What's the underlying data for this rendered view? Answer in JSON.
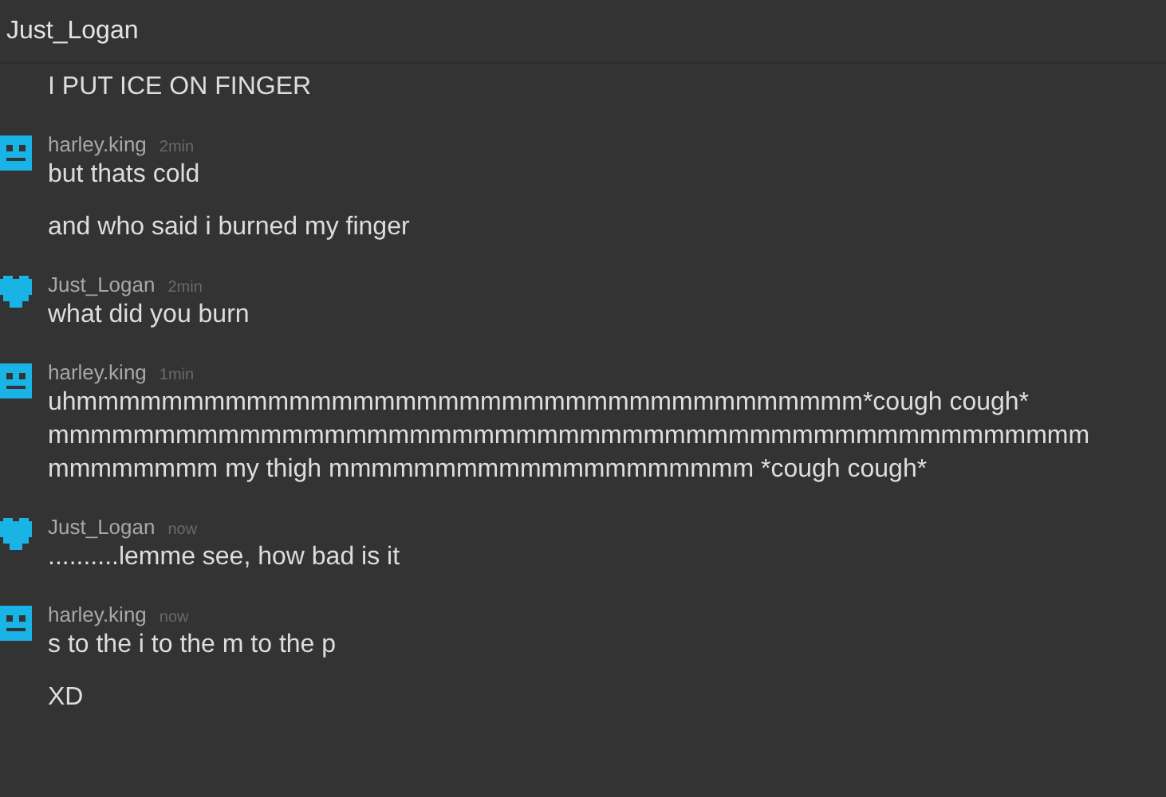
{
  "header": {
    "title": "Just_Logan"
  },
  "messages": [
    {
      "kind": "continuation",
      "lines": [
        "I PUT ICE ON FINGER"
      ]
    },
    {
      "kind": "group",
      "avatar": {
        "kind": "face"
      },
      "author": "harley.king",
      "time": "2min",
      "lines": [
        "but thats cold"
      ]
    },
    {
      "kind": "continuation",
      "lines": [
        "and who said i burned my finger"
      ]
    },
    {
      "kind": "group",
      "avatar": {
        "kind": "heart"
      },
      "author": "Just_Logan",
      "time": "2min",
      "lines": [
        "what did you burn"
      ]
    },
    {
      "kind": "group",
      "avatar": {
        "kind": "face"
      },
      "author": "harley.king",
      "time": "1min",
      "lines": [
        "uhmmmmmmmmmmmmmmmmmmmmmmmmmmmmmmmmmmmmm*cough cough*",
        "mmmmmmmmmmmmmmmmmmmmmmmmmmmmmmmmmmmmmmmmmmmmmmmmm",
        "mmmmmmmm my thigh mmmmmmmmmmmmmmmmmmmm *cough cough*"
      ]
    },
    {
      "kind": "group",
      "avatar": {
        "kind": "heart"
      },
      "author": "Just_Logan",
      "time": "now",
      "lines": [
        "..........lemme see, how bad is it"
      ]
    },
    {
      "kind": "group",
      "avatar": {
        "kind": "face"
      },
      "author": "harley.king",
      "time": "now",
      "lines": [
        "s to the i to the m to the p"
      ]
    },
    {
      "kind": "continuation",
      "lines": [
        "XD"
      ]
    }
  ]
}
